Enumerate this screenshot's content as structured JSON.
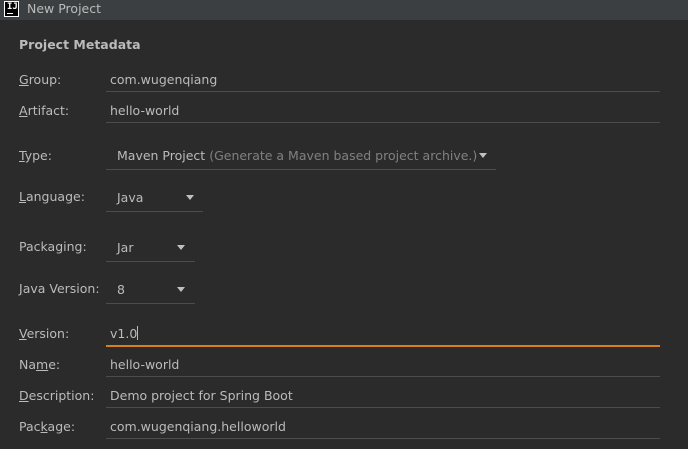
{
  "window": {
    "icon_text": "IJ",
    "title": "New Project"
  },
  "section_title": "Project Metadata",
  "fields": {
    "group": {
      "label_mnemonic": "G",
      "label_rest": "roup:",
      "value": "com.wugenqiang"
    },
    "artifact": {
      "label_mnemonic": "A",
      "label_rest": "rtifact:",
      "value": "hello-world"
    },
    "type": {
      "label_mnemonic": "T",
      "label_rest": "ype:",
      "value": "Maven Project",
      "hint": "(Generate a Maven based project archive.)"
    },
    "language": {
      "label_mnemonic": "L",
      "label_rest": "anguage:",
      "value": "Java"
    },
    "packaging": {
      "label": "Packaging:",
      "value": "Jar"
    },
    "java_version": {
      "label_mnemonic": "J",
      "label_rest": "ava Version:",
      "value": "8"
    },
    "version": {
      "label_mnemonic": "V",
      "label_rest": "ersion:",
      "value": "v1.0"
    },
    "name": {
      "label_pre": "Na",
      "label_mnemonic": "m",
      "label_rest": "e:",
      "value": "hello-world"
    },
    "description": {
      "label_mnemonic": "D",
      "label_rest": "escription:",
      "value": "Demo project for Spring Boot"
    },
    "package": {
      "label_pre": "Pac",
      "label_mnemonic": "k",
      "label_rest": "age:",
      "value": "com.wugenqiang.helloworld"
    }
  },
  "colors": {
    "background": "#2b2b2b",
    "titlebar": "#3c3f41",
    "text": "#bbbbbb",
    "hint": "#808080",
    "focus_accent": "#d5801e",
    "underline": "#4a4d50"
  },
  "icons": [
    "intellij-app-icon",
    "chevron-down-icon"
  ]
}
